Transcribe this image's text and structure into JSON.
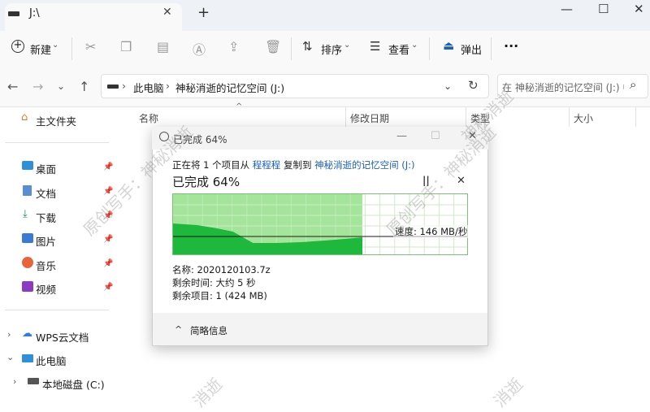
{
  "window": {
    "tab_title": "J:\\",
    "tab_close": "✕",
    "new_tab": "+",
    "minimize": "—",
    "maximize": "☐",
    "close": "✕"
  },
  "toolbar": {
    "new_label": "新建",
    "sort_label": "排序",
    "view_label": "查看",
    "eject_label": "弹出",
    "more_label": "···"
  },
  "address": {
    "crumbs": [
      "此电脑",
      "神秘消逝的记忆空间 (J:)"
    ],
    "search_placeholder": "在 神秘消逝的记忆空间 (J:) 中..."
  },
  "sidebar": {
    "home": "主文件夹",
    "quick_access": [
      {
        "label": "桌面",
        "icon": "desktop-icon"
      },
      {
        "label": "文档",
        "icon": "document-icon"
      },
      {
        "label": "下载",
        "icon": "download-icon"
      },
      {
        "label": "图片",
        "icon": "picture-icon"
      },
      {
        "label": "音乐",
        "icon": "music-icon"
      },
      {
        "label": "视频",
        "icon": "video-icon"
      }
    ],
    "wps": "WPS云文档",
    "this_pc": "此电脑",
    "local_disk": "本地磁盘 (C:)"
  },
  "columns": [
    "名称",
    "修改日期",
    "类型",
    "大小"
  ],
  "dialog": {
    "title": "已完成 64%",
    "copy_prefix": "正在将 1 个项目从",
    "source": "程程程",
    "copy_mid": "复制到",
    "destination": "神秘消逝的记忆空间 (J:)",
    "heading": "已完成 64%",
    "pause": "||",
    "cancel": "✕",
    "speed": "速度: 146 MB/秒",
    "name_line": "名称:  2020120103.7z",
    "time_line": "剩余时间:  大约 5 秒",
    "items_line": "剩余项目:  1 (424 MB)",
    "details_label": "简略信息",
    "progress": 0.64,
    "colors": {
      "done": "#a5e59b",
      "speed_fill": "#1eb83c",
      "grid": "#cfe9c9",
      "link": "#1a5fb4"
    }
  },
  "watermarks": [
    "原创写手：神秘消逝",
    "原创写手：神秘消逝",
    "神秘消逝",
    "消逝",
    "消逝"
  ]
}
